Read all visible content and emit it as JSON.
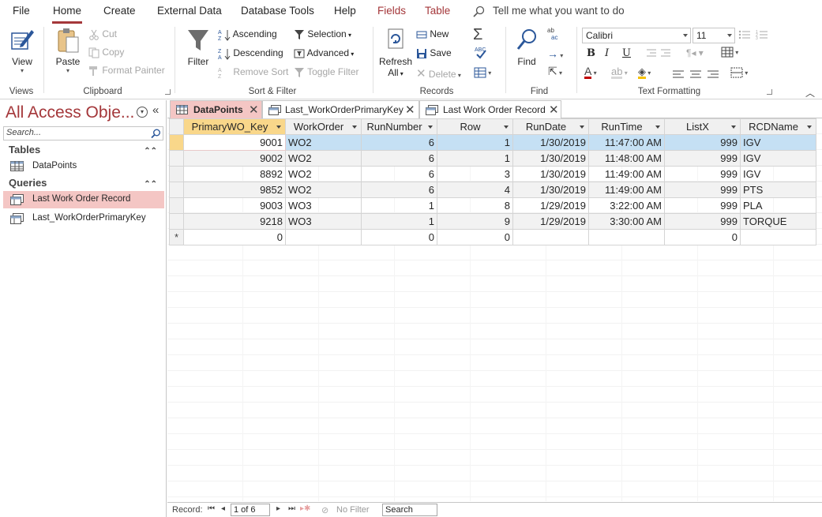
{
  "menu": {
    "tabs": [
      {
        "label": "File"
      },
      {
        "label": "Home"
      },
      {
        "label": "Create"
      },
      {
        "label": "External Data"
      },
      {
        "label": "Database Tools"
      },
      {
        "label": "Help"
      },
      {
        "label": "Fields"
      },
      {
        "label": "Table"
      }
    ],
    "tell_me": "Tell me what you want to do"
  },
  "ribbon": {
    "views": {
      "view_label": "View",
      "group": "Views"
    },
    "clipboard": {
      "paste": "Paste",
      "cut": "Cut",
      "copy": "Copy",
      "format_painter": "Format Painter",
      "group": "Clipboard"
    },
    "sort_filter": {
      "filter": "Filter",
      "ascending": "Ascending",
      "descending": "Descending",
      "remove_sort": "Remove Sort",
      "selection": "Selection",
      "advanced": "Advanced",
      "toggle_filter": "Toggle Filter",
      "group": "Sort & Filter"
    },
    "records": {
      "refresh": "Refresh",
      "refresh_all": "All",
      "new": "New",
      "save": "Save",
      "delete": "Delete",
      "group": "Records"
    },
    "find": {
      "find": "Find",
      "group": "Find"
    },
    "text_formatting": {
      "font": "Calibri",
      "size": "11",
      "bold": "B",
      "italic": "I",
      "underline": "U",
      "group": "Text Formatting"
    }
  },
  "nav": {
    "title": "All Access Obje...",
    "search_placeholder": "Search...",
    "sections": [
      {
        "label": "Tables",
        "items": [
          {
            "label": "DataPoints"
          }
        ]
      },
      {
        "label": "Queries",
        "items": [
          {
            "label": "Last Work Order Record"
          },
          {
            "label": "Last_WorkOrderPrimaryKey"
          }
        ]
      }
    ]
  },
  "doc_tabs": [
    {
      "label": "DataPoints"
    },
    {
      "label": "Last_WorkOrderPrimaryKey"
    },
    {
      "label": "Last Work Order Record"
    }
  ],
  "datasheet": {
    "columns": [
      "PrimaryWO_Key",
      "WorkOrder",
      "RunNumber",
      "Row",
      "RunDate",
      "RunTime",
      "ListX",
      "RCDName"
    ],
    "rows": [
      [
        "9001",
        "WO2",
        "6",
        "1",
        "1/30/2019",
        "11:47:00 AM",
        "999",
        "IGV"
      ],
      [
        "9002",
        "WO2",
        "6",
        "1",
        "1/30/2019",
        "11:48:00 AM",
        "999",
        "IGV"
      ],
      [
        "8892",
        "WO2",
        "6",
        "3",
        "1/30/2019",
        "11:49:00 AM",
        "999",
        "IGV"
      ],
      [
        "9852",
        "WO2",
        "6",
        "4",
        "1/30/2019",
        "11:49:00 AM",
        "999",
        "PTS"
      ],
      [
        "9003",
        "WO3",
        "1",
        "8",
        "1/29/2019",
        "3:22:00 AM",
        "999",
        "PLA"
      ],
      [
        "9218",
        "WO3",
        "1",
        "9",
        "1/29/2019",
        "3:30:00 AM",
        "999",
        "TORQUE"
      ]
    ],
    "new_row": [
      "0",
      "",
      "0",
      "0",
      "",
      "",
      "0",
      ""
    ],
    "new_row_marker": "*"
  },
  "status": {
    "record_label": "Record:",
    "record_value": "1 of 6",
    "no_filter": "No Filter",
    "search": "Search"
  },
  "colors": {
    "accent": "#a4373a",
    "selected_row": "#c5e0f4",
    "header_highlight": "#f9d78a",
    "nav_selected": "#f4c6c4"
  }
}
